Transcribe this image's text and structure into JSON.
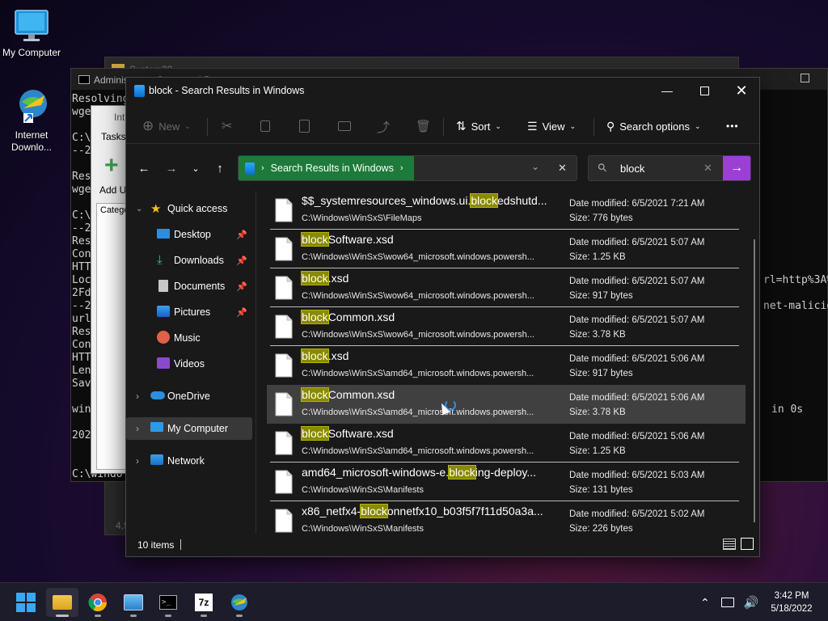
{
  "desktop": {
    "icons": [
      {
        "label": "My Computer"
      },
      {
        "label": "Internet Downlo..."
      }
    ]
  },
  "bg_windows": {
    "cmd": {
      "title": "Administrator: Command Prompt",
      "lines_left": [
        "Resolving",
        "wget",
        "",
        "C:\\",
        "--2",
        "",
        "Res",
        "wge",
        "",
        "C:\\",
        "--2",
        "Res",
        "Con",
        "HTT",
        "Loc",
        "2Fd",
        "--2",
        "url",
        "Res",
        "Con",
        "HTT",
        "Len",
        "Sav",
        "",
        "win",
        "",
        "202",
        "",
        "",
        "C:\\windo"
      ],
      "right_frag_1": "rl=http%3A%",
      "right_frag_2": "net-malicio",
      "right_frag_3": "in 0s"
    },
    "idm": {
      "title": "Int",
      "tasks_tab": "Tasks",
      "add_label": "Add U",
      "categ_label": "Catego",
      "footer": "4,5"
    },
    "back": {
      "title": "System32"
    }
  },
  "explorer": {
    "title": "block - Search Results in Windows",
    "toolbar": {
      "new": "New",
      "sort": "Sort",
      "view": "View",
      "search_options": "Search options",
      "more": "•••"
    },
    "address": {
      "location": "Search Results in Windows"
    },
    "search": {
      "query": "block"
    },
    "nav": {
      "quick_access": "Quick access",
      "items": [
        {
          "label": "Desktop"
        },
        {
          "label": "Downloads"
        },
        {
          "label": "Documents"
        },
        {
          "label": "Pictures"
        },
        {
          "label": "Music"
        },
        {
          "label": "Videos"
        }
      ],
      "onedrive": "OneDrive",
      "my_computer": "My Computer",
      "network": "Network"
    },
    "date_prefix": "Date modified: ",
    "size_prefix": "Size: ",
    "files": [
      {
        "pre": "$$_systemresources_windows.ui.",
        "hl": "block",
        "post": "edshutd...",
        "path": "C:\\Windows\\WinSxS\\FileMaps",
        "date": "6/5/2021 7:21 AM",
        "size": "776 bytes"
      },
      {
        "pre": "",
        "hl": "block",
        "post": "Software.xsd",
        "path": "C:\\Windows\\WinSxS\\wow64_microsoft.windows.powersh...",
        "date": "6/5/2021 5:07 AM",
        "size": "1.25 KB"
      },
      {
        "pre": "",
        "hl": "block",
        "post": ".xsd",
        "path": "C:\\Windows\\WinSxS\\wow64_microsoft.windows.powersh...",
        "date": "6/5/2021 5:07 AM",
        "size": "917 bytes"
      },
      {
        "pre": "",
        "hl": "block",
        "post": "Common.xsd",
        "path": "C:\\Windows\\WinSxS\\wow64_microsoft.windows.powersh...",
        "date": "6/5/2021 5:07 AM",
        "size": "3.78 KB"
      },
      {
        "pre": "",
        "hl": "block",
        "post": ".xsd",
        "path": "C:\\Windows\\WinSxS\\amd64_microsoft.windows.powersh...",
        "date": "6/5/2021 5:06 AM",
        "size": "917 bytes"
      },
      {
        "pre": "",
        "hl": "block",
        "post": "Common.xsd",
        "path": "C:\\Windows\\WinSxS\\amd64_microsoft.windows.powersh...",
        "date": "6/5/2021 5:06 AM",
        "size": "3.78 KB"
      },
      {
        "pre": "",
        "hl": "block",
        "post": "Software.xsd",
        "path": "C:\\Windows\\WinSxS\\amd64_microsoft.windows.powersh...",
        "date": "6/5/2021 5:06 AM",
        "size": "1.25 KB"
      },
      {
        "pre": "amd64_microsoft-windows-e.",
        "hl": "block",
        "post": "ing-deploy...",
        "path": "C:\\Windows\\WinSxS\\Manifests",
        "date": "6/5/2021 5:03 AM",
        "size": "131 bytes"
      },
      {
        "pre": "x86_netfx4-",
        "hl": "block",
        "post": "onnetfx10_b03f5f7f11d50a3a...",
        "path": "C:\\Windows\\WinSxS\\Manifests",
        "date": "6/5/2021 5:02 AM",
        "size": "226 bytes"
      }
    ],
    "status": {
      "items": "10 items"
    }
  },
  "taskbar": {
    "apps": [
      {
        "name": "start-button"
      },
      {
        "name": "file-explorer"
      },
      {
        "name": "chrome"
      },
      {
        "name": "control-panel"
      },
      {
        "name": "command-prompt"
      },
      {
        "name": "7zip",
        "text": "7z"
      },
      {
        "name": "internet-download-manager"
      }
    ],
    "time": "3:42 PM",
    "date": "5/18/2022"
  }
}
